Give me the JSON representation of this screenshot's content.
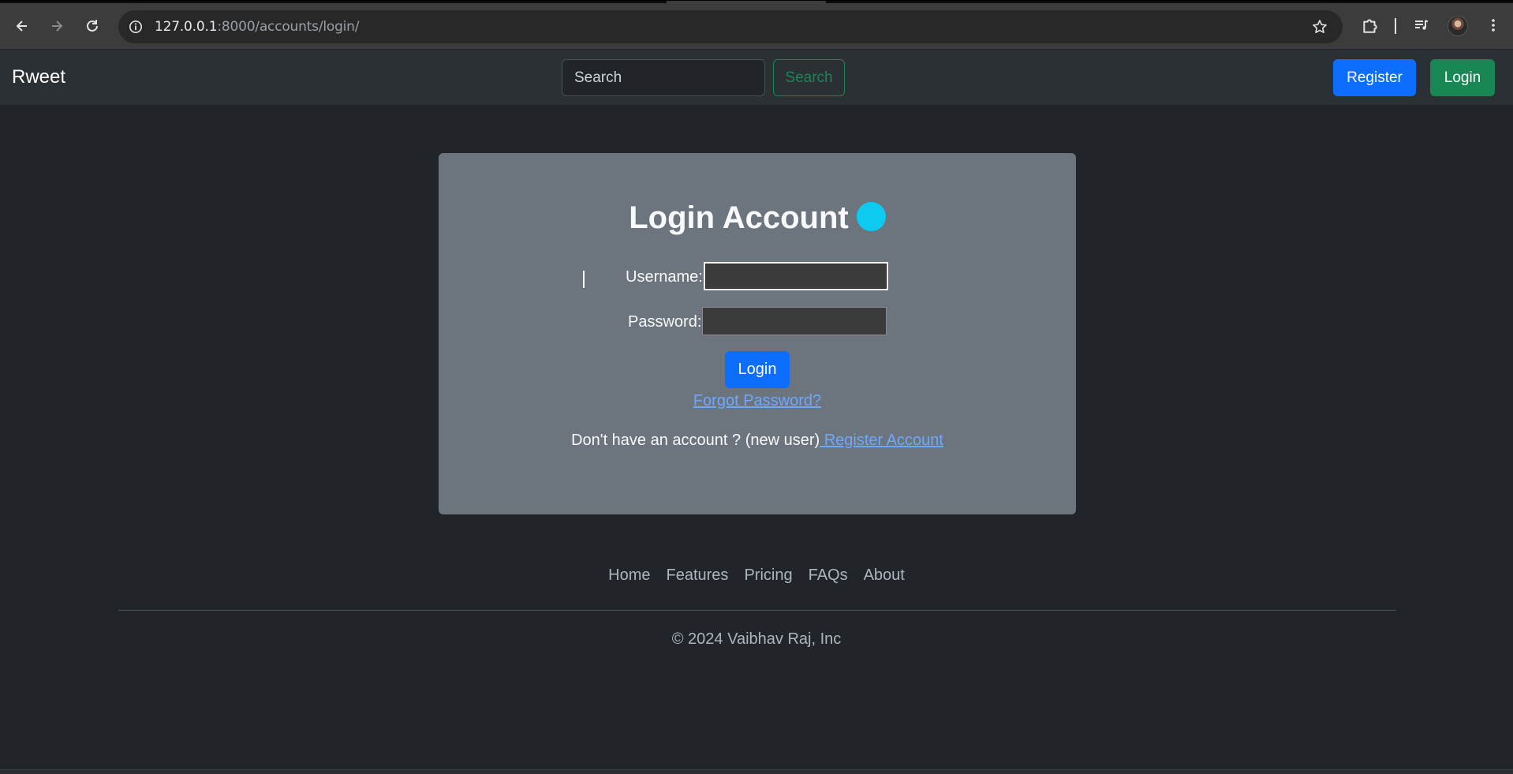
{
  "browser": {
    "url_host": "127.0.0.1",
    "url_rest": ":8000/accounts/login/"
  },
  "navbar": {
    "brand": "Rweet",
    "search_placeholder": "Search",
    "search_button": "Search",
    "register_button": "Register",
    "login_button": "Login"
  },
  "login_card": {
    "title": "Login Account",
    "username_label": "Username:",
    "username_value": "",
    "password_label": "Password:",
    "password_value": "",
    "login_button": "Login",
    "forgot_link": "Forgot Password?",
    "register_prompt": "Don't have an account ? (new user)",
    "register_link": " Register Account"
  },
  "footer": {
    "links": [
      "Home",
      "Features",
      "Pricing",
      "FAQs",
      "About"
    ],
    "copyright": "© 2024 Vaibhav Raj, Inc"
  },
  "colors": {
    "page_bg": "#212529",
    "navbar_bg": "#2b3035",
    "card_bg": "#6c757d",
    "primary": "#0d6efd",
    "success": "#198754",
    "info_dot": "#0dcaf0",
    "link": "#6ea8fe"
  },
  "icons": {
    "back": "arrow-left-icon",
    "forward": "arrow-right-icon",
    "reload": "reload-icon",
    "site_info": "info-icon",
    "bookmark": "star-icon",
    "extensions": "puzzle-icon",
    "media": "media-queue-icon",
    "menu": "kebab-menu-icon"
  }
}
